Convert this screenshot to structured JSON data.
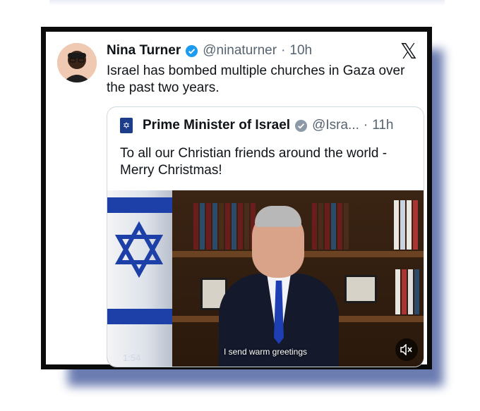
{
  "tweet": {
    "author_name": "Nina Turner",
    "author_handle": "@ninaturner",
    "separator": "·",
    "time": "10h",
    "text": "Israel has bombed multiple churches in Gaza over the past two years.",
    "platform_icon": "x-logo-icon",
    "verified_color": "#1d9bf0"
  },
  "quoted_tweet": {
    "author_name": "Prime Minister of Israel",
    "author_handle": "@Isra...",
    "separator": "·",
    "time": "11h",
    "text": "To all our Christian friends around the world - Merry Christmas!",
    "verified_color": "#8b98a5",
    "video": {
      "caption": "I send warm greetings",
      "duration": "1:54",
      "mute_icon": "volume-muted-icon"
    }
  }
}
